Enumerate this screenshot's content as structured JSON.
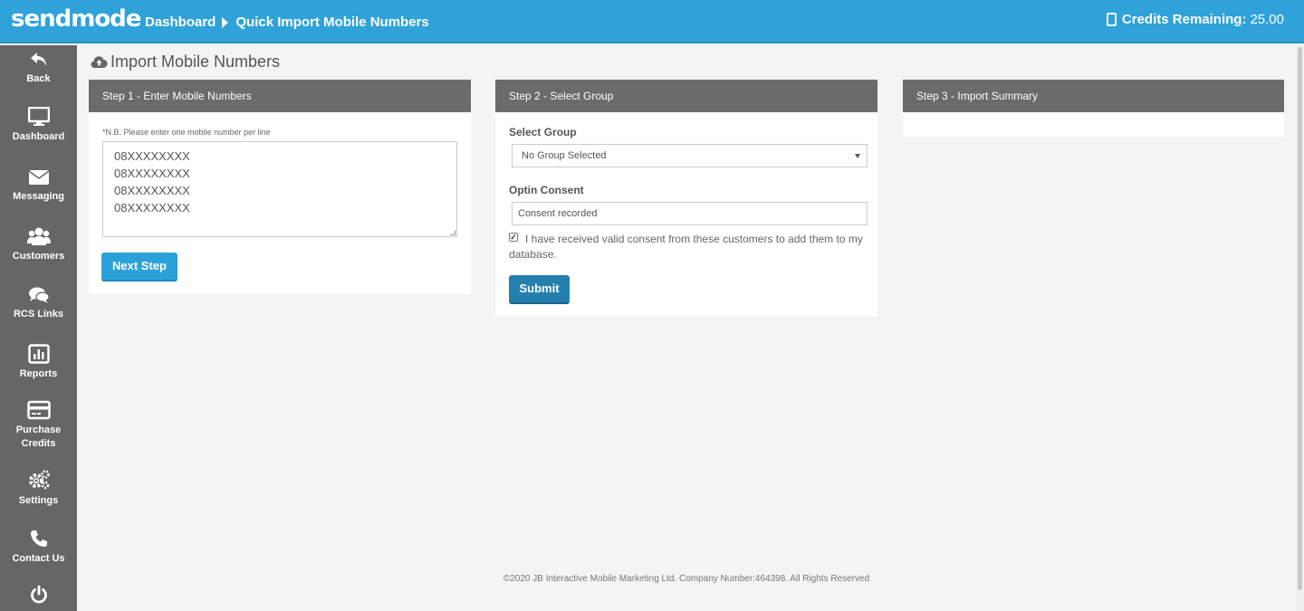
{
  "header": {
    "logo": "sendmode",
    "breadcrumb": [
      "Dashboard",
      "Quick Import Mobile Numbers"
    ],
    "credits_label": "Credits Remaining:",
    "credits_value": "25.00"
  },
  "sidebar": {
    "items": [
      {
        "label": "Back",
        "icon": "back-arrow-icon"
      },
      {
        "label": "Dashboard",
        "icon": "monitor-icon"
      },
      {
        "label": "Messaging",
        "icon": "envelope-icon"
      },
      {
        "label": "Customers",
        "icon": "users-icon"
      },
      {
        "label": "RCS Links",
        "icon": "chat-bubbles-icon"
      },
      {
        "label": "Reports",
        "icon": "bar-chart-icon"
      },
      {
        "label": "Purchase Credits",
        "icon": "credit-card-icon"
      },
      {
        "label": "Settings",
        "icon": "gears-icon"
      },
      {
        "label": "Contact Us",
        "icon": "phone-icon"
      },
      {
        "label": "",
        "icon": "power-icon"
      }
    ]
  },
  "page": {
    "title": "Import Mobile Numbers",
    "title_icon": "cloud-upload-icon"
  },
  "step1": {
    "heading": "Step 1 - Enter Mobile Numbers",
    "note": "*N.B. Please enter one mobile number per line",
    "numbers": "08XXXXXXXX\n08XXXXXXXX\n08XXXXXXXX\n08XXXXXXXX",
    "next_label": "Next Step"
  },
  "step2": {
    "heading": "Step 2 - Select Group",
    "select_group_label": "Select Group",
    "select_group_value": "No Group Selected",
    "optin_label": "Optin Consent",
    "optin_value": "Consent recorded",
    "consent_checked": true,
    "consent_text": "I have received valid consent from these customers to add them to my database.",
    "submit_label": "Submit"
  },
  "step3": {
    "heading": "Step 3 - Import Summary"
  },
  "footer": {
    "text": "©2020 JB Interactive Mobile Marketing Ltd. Company Number:464398. All Rights Reserved"
  },
  "colors": {
    "topbar": "#2fa2d9",
    "sidebar": "#666666",
    "panel_header": "#6b6b6b",
    "next_button": "#2ba1db",
    "submit_button": "#247fae"
  }
}
